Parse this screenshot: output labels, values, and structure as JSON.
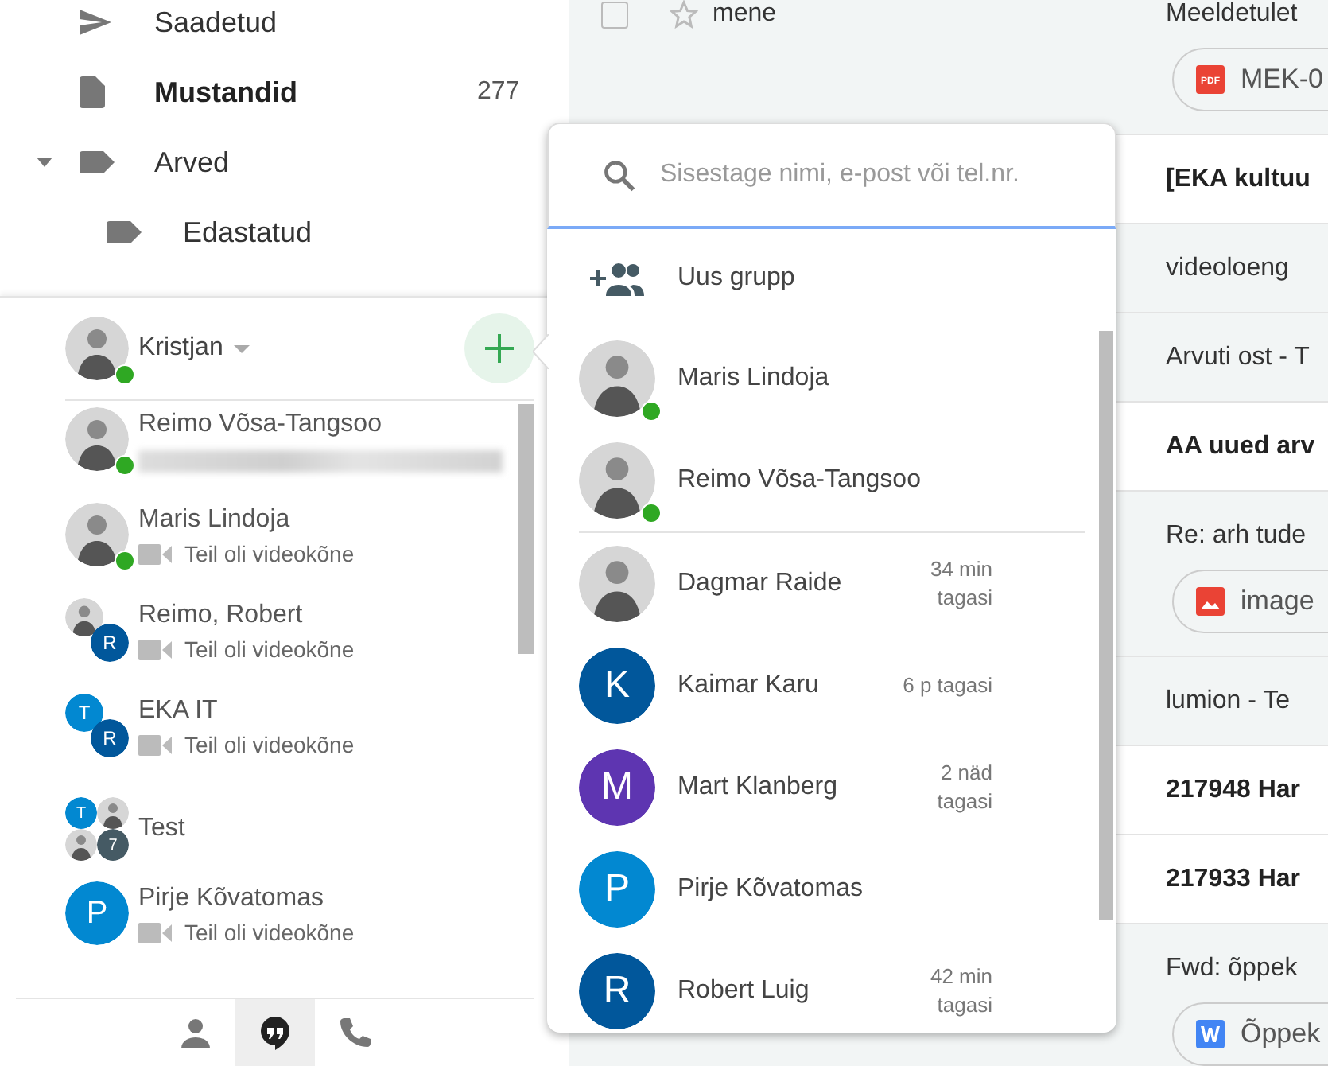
{
  "nav": [
    {
      "label": "Saadetud",
      "kind": "sent",
      "unread": false
    },
    {
      "label": "Mustandid",
      "kind": "draft",
      "unread": true,
      "count": "277"
    },
    {
      "label": "Arved",
      "kind": "label",
      "unread": false,
      "expanded": true,
      "children": [
        {
          "label": "Edastatud",
          "kind": "label",
          "unread": false
        }
      ]
    }
  ],
  "hangouts": {
    "user": {
      "name": "Kristjan",
      "online": true,
      "avatar": {
        "kind": "photo"
      }
    },
    "conversations": [
      {
        "name": "Reimo Võsa-Tangsoo",
        "online": true,
        "avatars": [
          {
            "kind": "photo"
          }
        ],
        "line": {
          "kind": "blurred"
        }
      },
      {
        "name": "Maris Lindoja",
        "online": true,
        "avatars": [
          {
            "kind": "photo"
          }
        ],
        "line": {
          "kind": "video",
          "text": "Teil oli videokõne"
        }
      },
      {
        "name": "Reimo, Robert",
        "online": false,
        "avatars": [
          {
            "kind": "photo"
          },
          {
            "kind": "letter",
            "letter": "R",
            "color": "#01579b"
          }
        ],
        "line": {
          "kind": "video",
          "text": "Teil oli videokõne"
        }
      },
      {
        "name": "EKA IT",
        "online": false,
        "avatars": [
          {
            "kind": "letter",
            "letter": "T",
            "color": "#0288d1"
          },
          {
            "kind": "letter",
            "letter": "R",
            "color": "#01579b"
          }
        ],
        "line": {
          "kind": "video",
          "text": "Teil oli videokõne"
        }
      },
      {
        "name": "Test",
        "online": false,
        "avatars": [
          {
            "kind": "letter",
            "letter": "T",
            "color": "#0288d1"
          },
          {
            "kind": "photo"
          },
          {
            "kind": "photo"
          },
          {
            "kind": "letter",
            "letter": "7",
            "color": "#455a64"
          }
        ]
      },
      {
        "name": "Pirje Kõvatomas",
        "online": false,
        "avatars": [
          {
            "kind": "letter",
            "letter": "P",
            "color": "#0288d1"
          }
        ],
        "line": {
          "kind": "video",
          "text": "Teil oli videokõne"
        }
      }
    ],
    "tabs": [
      {
        "kind": "people",
        "selected": false
      },
      {
        "kind": "chat",
        "selected": true
      },
      {
        "kind": "phone",
        "selected": false
      }
    ]
  },
  "mail": [
    {
      "sender": "mene",
      "subject": "Meeldetulet",
      "unread": false,
      "attachment": {
        "kind": "pdf",
        "icon_text": "PDF",
        "label": "MEK-0"
      }
    },
    {
      "subject": "[EKA kultuu",
      "unread": true
    },
    {
      "subject": "videoloeng",
      "unread": false
    },
    {
      "subject": "Arvuti ost - T",
      "unread": false
    },
    {
      "subject": "AA uued arv",
      "unread": true
    },
    {
      "subject": "Re: arh tude",
      "unread": false,
      "attachment": {
        "kind": "image",
        "label": "image"
      }
    },
    {
      "subject": "lumion - Te",
      "unread": false
    },
    {
      "subject": "217948 Har",
      "unread": true
    },
    {
      "subject": "217933 Har",
      "unread": true
    },
    {
      "subject": "Fwd: õppek",
      "unread": false,
      "attachment": {
        "kind": "word",
        "label": "Õppek"
      }
    }
  ],
  "new_chat": {
    "search": {
      "placeholder": "Sisestage nimi, e-post või tel.nr."
    },
    "new_group": "Uus grupp",
    "sections": [
      {
        "contacts": [
          {
            "name": "Maris Lindoja",
            "online": true,
            "avatar": {
              "kind": "photo"
            }
          },
          {
            "name": "Reimo Võsa-Tangsoo",
            "online": true,
            "avatar": {
              "kind": "photo"
            }
          }
        ]
      },
      {
        "contacts": [
          {
            "name": "Dagmar Raide",
            "online": false,
            "avatar": {
              "kind": "photo"
            },
            "time": "34 min tagasi"
          },
          {
            "name": "Kaimar Karu",
            "online": false,
            "avatar": {
              "kind": "letter",
              "letter": "K",
              "color": "#01579b"
            },
            "time": "6 p tagasi"
          },
          {
            "name": "Mart Klanberg",
            "online": false,
            "avatar": {
              "kind": "letter",
              "letter": "M",
              "color": "#5e35b1"
            },
            "time": "2 näd tagasi"
          },
          {
            "name": "Pirje Kõvatomas",
            "online": false,
            "avatar": {
              "kind": "letter",
              "letter": "P",
              "color": "#0288d1"
            }
          },
          {
            "name": "Robert Luig",
            "online": false,
            "avatar": {
              "kind": "letter",
              "letter": "R",
              "color": "#01579b"
            },
            "time": "42 min tagasi"
          }
        ]
      }
    ]
  }
}
